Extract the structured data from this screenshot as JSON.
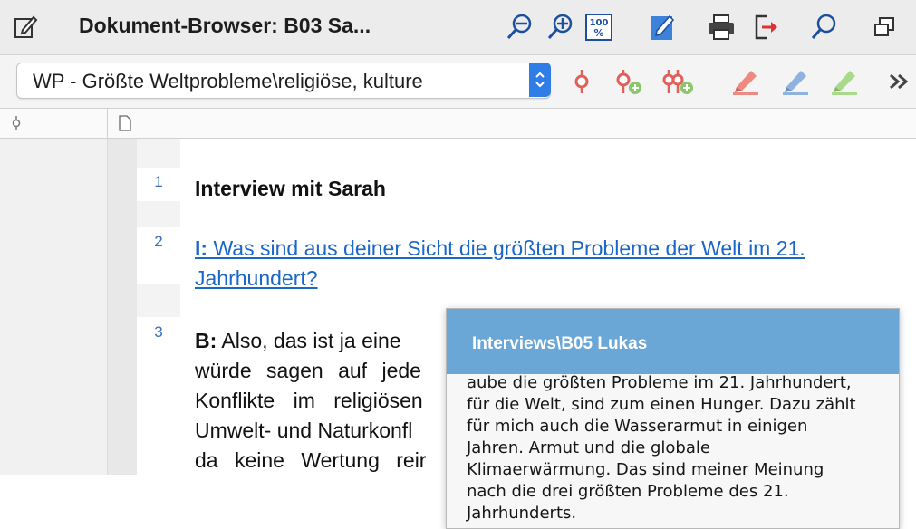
{
  "window": {
    "title": "Dokument-Browser: B03 Sa..."
  },
  "toolbar": {
    "zoom_reset_label": "100",
    "document_selector_value": "WP - Größte Weltprobleme\\religiöse, kulture"
  },
  "document": {
    "lines": [
      {
        "number": "1",
        "text": "Interview mit Sarah"
      },
      {
        "number": "2",
        "speaker": "I:",
        "text": " Was sind aus deiner Sicht die größten Probleme der Welt im 21. Jahrhundert?"
      },
      {
        "number": "3",
        "speaker": "B:"
      }
    ],
    "answer_lines": [
      " Also, das ist ja eine",
      "würde sagen auf jede",
      "Konflikte im religiösen",
      "Umwelt- und Naturkonfl",
      "da keine Wertung reir"
    ]
  },
  "popup": {
    "title": "Interviews\\B05 Lukas",
    "lines": [
      "aube die größten Probleme im 21. Jahrhundert,",
      "für die Welt, sind zum einen Hunger. Dazu zählt",
      "für mich auch die Wasserarmut in einigen",
      "Jahren. Armut und die globale",
      "Klimaerwärmung. Das sind meiner Meinung",
      "nach die drei größten Probleme des 21.",
      "Jahrhunderts."
    ]
  },
  "colors": {
    "accent_blue": "#2f7ee7",
    "link_blue": "#1a66c9",
    "popup_header": "#6aa6d6",
    "code_red": "#e0605a",
    "highlight_red": "#ef8a82",
    "highlight_blue": "#8fb3e0",
    "highlight_green": "#a9d98a"
  },
  "icons": [
    "edit-document-icon",
    "zoom-out-icon",
    "zoom-in-icon",
    "zoom-100-icon",
    "edit-mode-icon",
    "print-icon",
    "export-icon",
    "search-icon",
    "window-icon",
    "code-icon",
    "code-add-icon",
    "multi-code-add-icon",
    "highlight-red-icon",
    "highlight-blue-icon",
    "highlight-green-icon",
    "more-icon",
    "codes-column-icon",
    "document-column-icon"
  ]
}
